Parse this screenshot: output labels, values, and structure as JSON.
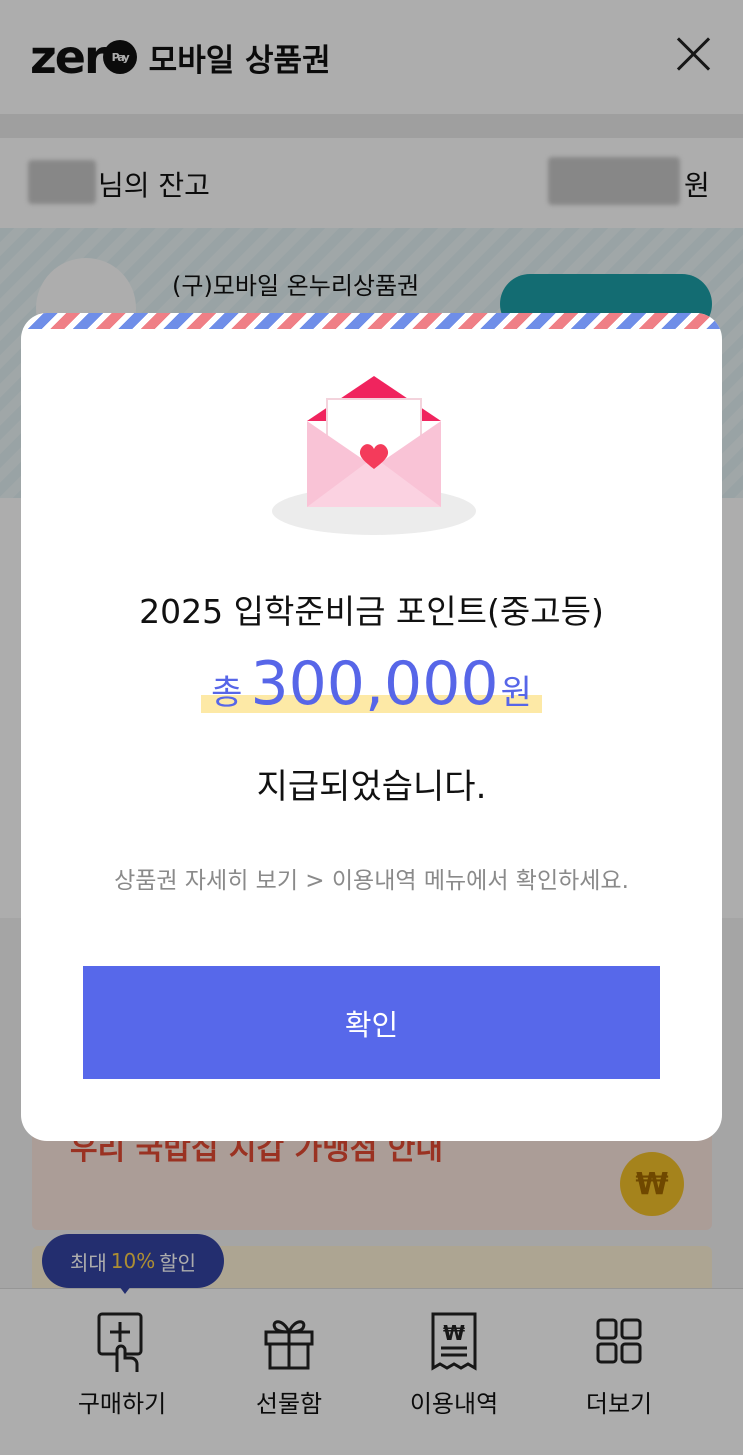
{
  "header": {
    "brand_word": "zer",
    "brand_pay": "Pay",
    "title": "모바일 상품권"
  },
  "balance": {
    "label": "님의 잔고",
    "unit": "원"
  },
  "voucher_card": {
    "title": "(구)모바일 온누리상품권"
  },
  "banner": {
    "text": "우리 국밥집 지갑 가맹점 안내",
    "coin_symbol": "₩"
  },
  "promo": {
    "prefix": "최대",
    "percent": "10%",
    "suffix": "할인"
  },
  "tabs": [
    {
      "label": "구매하기",
      "icon": "buy-icon"
    },
    {
      "label": "선물함",
      "icon": "gift-icon"
    },
    {
      "label": "이용내역",
      "icon": "receipt-icon"
    },
    {
      "label": "더보기",
      "icon": "grid-icon"
    }
  ],
  "modal": {
    "title": "2025 입학준비금 포인트(중고등)",
    "amount_prefix": "총",
    "amount": "300,000",
    "amount_unit": "원",
    "subtitle": "지급되었습니다.",
    "hint": "상품권 자세히 보기 > 이용내역 메뉴에서 확인하세요.",
    "confirm_label": "확인"
  },
  "colors": {
    "accent": "#5768ea",
    "amount_text": "#5766e8",
    "highlight": "#fde9a6",
    "promo_bg": "#3444a4",
    "promo_percent": "#ffd24a"
  }
}
